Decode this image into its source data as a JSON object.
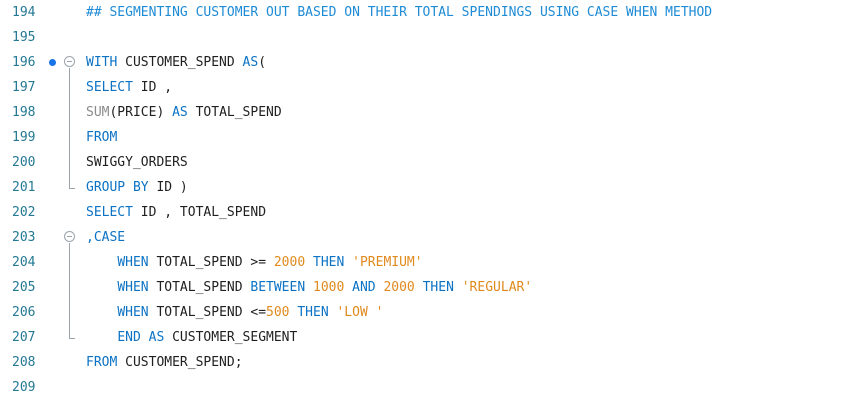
{
  "editor": {
    "lines": [
      {
        "num": "194",
        "tokens": [
          {
            "t": "## SEGMENTING CUSTOMER OUT BASED ON THEIR TOTAL SPENDINGS USING CASE WHEN METHOD",
            "c": "cm"
          }
        ]
      },
      {
        "num": "195",
        "tokens": []
      },
      {
        "num": "196",
        "tokens": [
          {
            "t": "WITH",
            "c": "kw"
          },
          {
            "t": " CUSTOMER_SPEND ",
            "c": ""
          },
          {
            "t": "AS",
            "c": "kw"
          },
          {
            "t": "(",
            "c": ""
          }
        ]
      },
      {
        "num": "197",
        "tokens": [
          {
            "t": "SELECT",
            "c": "kw"
          },
          {
            "t": " ID ,",
            "c": ""
          }
        ]
      },
      {
        "num": "198",
        "tokens": [
          {
            "t": "SUM",
            "c": "fn"
          },
          {
            "t": "(PRICE) ",
            "c": ""
          },
          {
            "t": "AS",
            "c": "kw"
          },
          {
            "t": " TOTAL_SPEND",
            "c": ""
          }
        ]
      },
      {
        "num": "199",
        "tokens": [
          {
            "t": "FROM",
            "c": "kw"
          }
        ]
      },
      {
        "num": "200",
        "tokens": [
          {
            "t": "SWIGGY_ORDERS",
            "c": ""
          }
        ]
      },
      {
        "num": "201",
        "tokens": [
          {
            "t": "GROUP BY",
            "c": "kw"
          },
          {
            "t": " ID )",
            "c": ""
          }
        ]
      },
      {
        "num": "202",
        "tokens": [
          {
            "t": "SELECT",
            "c": "kw"
          },
          {
            "t": " ID , TOTAL_SPEND",
            "c": ""
          }
        ]
      },
      {
        "num": "203",
        "tokens": [
          {
            "t": ",CASE",
            "c": "kw"
          }
        ]
      },
      {
        "num": "204",
        "tokens": [
          {
            "t": "    ",
            "c": ""
          },
          {
            "t": "WHEN",
            "c": "kw"
          },
          {
            "t": " TOTAL_SPEND >= ",
            "c": ""
          },
          {
            "t": "2000",
            "c": "num"
          },
          {
            "t": " ",
            "c": ""
          },
          {
            "t": "THEN",
            "c": "kw"
          },
          {
            "t": " ",
            "c": ""
          },
          {
            "t": "'PREMIUM'",
            "c": "str"
          }
        ]
      },
      {
        "num": "205",
        "tokens": [
          {
            "t": "    ",
            "c": ""
          },
          {
            "t": "WHEN",
            "c": "kw"
          },
          {
            "t": " TOTAL_SPEND ",
            "c": ""
          },
          {
            "t": "BETWEEN",
            "c": "kw"
          },
          {
            "t": " ",
            "c": ""
          },
          {
            "t": "1000",
            "c": "num"
          },
          {
            "t": " ",
            "c": ""
          },
          {
            "t": "AND",
            "c": "kw"
          },
          {
            "t": " ",
            "c": ""
          },
          {
            "t": "2000",
            "c": "num"
          },
          {
            "t": " ",
            "c": ""
          },
          {
            "t": "THEN",
            "c": "kw"
          },
          {
            "t": " ",
            "c": ""
          },
          {
            "t": "'REGULAR'",
            "c": "str"
          }
        ]
      },
      {
        "num": "206",
        "tokens": [
          {
            "t": "    ",
            "c": ""
          },
          {
            "t": "WHEN",
            "c": "kw"
          },
          {
            "t": " TOTAL_SPEND <=",
            "c": ""
          },
          {
            "t": "500",
            "c": "num"
          },
          {
            "t": " ",
            "c": ""
          },
          {
            "t": "THEN",
            "c": "kw"
          },
          {
            "t": " ",
            "c": ""
          },
          {
            "t": "'LOW '",
            "c": "str"
          }
        ]
      },
      {
        "num": "207",
        "tokens": [
          {
            "t": "    ",
            "c": ""
          },
          {
            "t": "END AS",
            "c": "kw"
          },
          {
            "t": " CUSTOMER_SEGMENT",
            "c": ""
          }
        ]
      },
      {
        "num": "208",
        "tokens": [
          {
            "t": "FROM",
            "c": "kw"
          },
          {
            "t": " CUSTOMER_SPEND;",
            "c": ""
          }
        ]
      },
      {
        "num": "209",
        "tokens": []
      }
    ],
    "markers": {
      "breakpoint_line": "196",
      "fold_lines": [
        "196",
        "203"
      ]
    },
    "colors": {
      "keyword": "#0b72c4",
      "number": "#e08a1e",
      "string": "#e08a1e",
      "comment": "#1e8bd6",
      "line_number": "#237893"
    }
  }
}
